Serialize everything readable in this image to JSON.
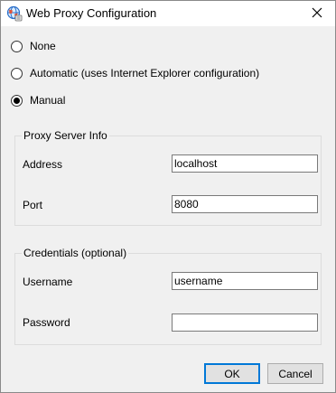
{
  "window": {
    "title": "Web Proxy Configuration"
  },
  "proxy_mode": {
    "options": [
      {
        "label": "None",
        "selected": false
      },
      {
        "label": "Automatic (uses Internet Explorer configuration)",
        "selected": false
      },
      {
        "label": "Manual",
        "selected": true
      }
    ]
  },
  "proxy_server_info": {
    "legend": "Proxy Server Info",
    "address_label": "Address",
    "address_value": "localhost",
    "port_label": "Port",
    "port_value": "8080"
  },
  "credentials": {
    "legend": "Credentials (optional)",
    "username_label": "Username",
    "username_value": "username",
    "password_label": "Password",
    "password_value": ""
  },
  "buttons": {
    "ok_label": "OK",
    "cancel_label": "Cancel"
  },
  "colors": {
    "default_button_border": "#0078d7",
    "dialog_background": "#f0f0f0"
  },
  "icons": {
    "title_icon": "globe-proxy-icon",
    "close_icon": "close-icon"
  }
}
